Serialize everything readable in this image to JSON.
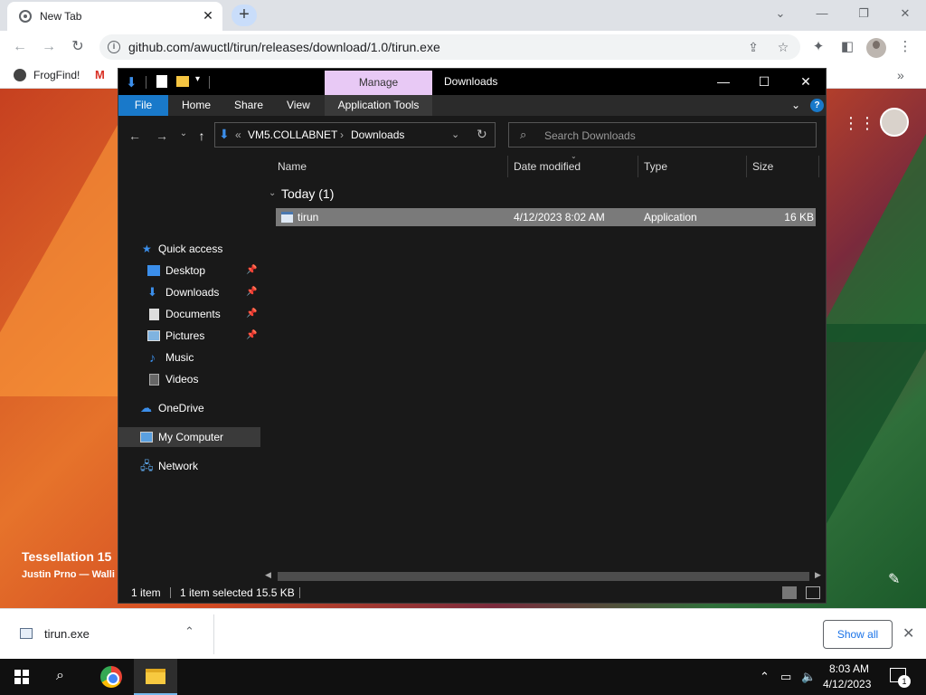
{
  "browser": {
    "tab_title": "New Tab",
    "tab_close": "✕",
    "new_tab": "+",
    "url": "github.com/awuctl/tirun/releases/download/1.0/tirun.exe",
    "bookmarks": [
      {
        "label": "FrogFind!"
      }
    ],
    "bookmarks_more": "»"
  },
  "page": {
    "wallpaper_title": "Tessellation 15",
    "wallpaper_credit": "Justin Prno — Walli"
  },
  "explorer": {
    "ribbon_context": "Manage",
    "window_title": "Downloads",
    "ribbon_tabs": {
      "file": "File",
      "home": "Home",
      "share": "Share",
      "view": "View",
      "app_tools": "Application Tools"
    },
    "address": {
      "overflow": "«",
      "crumbs": [
        "VM5.COLLABNET",
        "Downloads"
      ],
      "separator": "›"
    },
    "search_placeholder": "Search Downloads",
    "nav": {
      "quick_access": "Quick access",
      "desktop": "Desktop",
      "downloads": "Downloads",
      "documents": "Documents",
      "pictures": "Pictures",
      "music": "Music",
      "videos": "Videos",
      "onedrive": "OneDrive",
      "my_computer": "My Computer",
      "network": "Network"
    },
    "columns": {
      "name": "Name",
      "date": "Date modified",
      "type": "Type",
      "size": "Size"
    },
    "group": "Today (1)",
    "files": [
      {
        "name": "tirun",
        "date": "4/12/2023 8:02 AM",
        "type": "Application",
        "size": "16 KB"
      }
    ],
    "status": {
      "count": "1 item",
      "selected": "1 item selected  15.5 KB"
    },
    "accent_color": "#1979ca",
    "manage_color": "#e8c9f5"
  },
  "download_shelf": {
    "file_name": "tirun.exe",
    "show_all": "Show all"
  },
  "taskbar": {
    "time": "8:03 AM",
    "date": "4/12/2023",
    "notifications": "1"
  }
}
